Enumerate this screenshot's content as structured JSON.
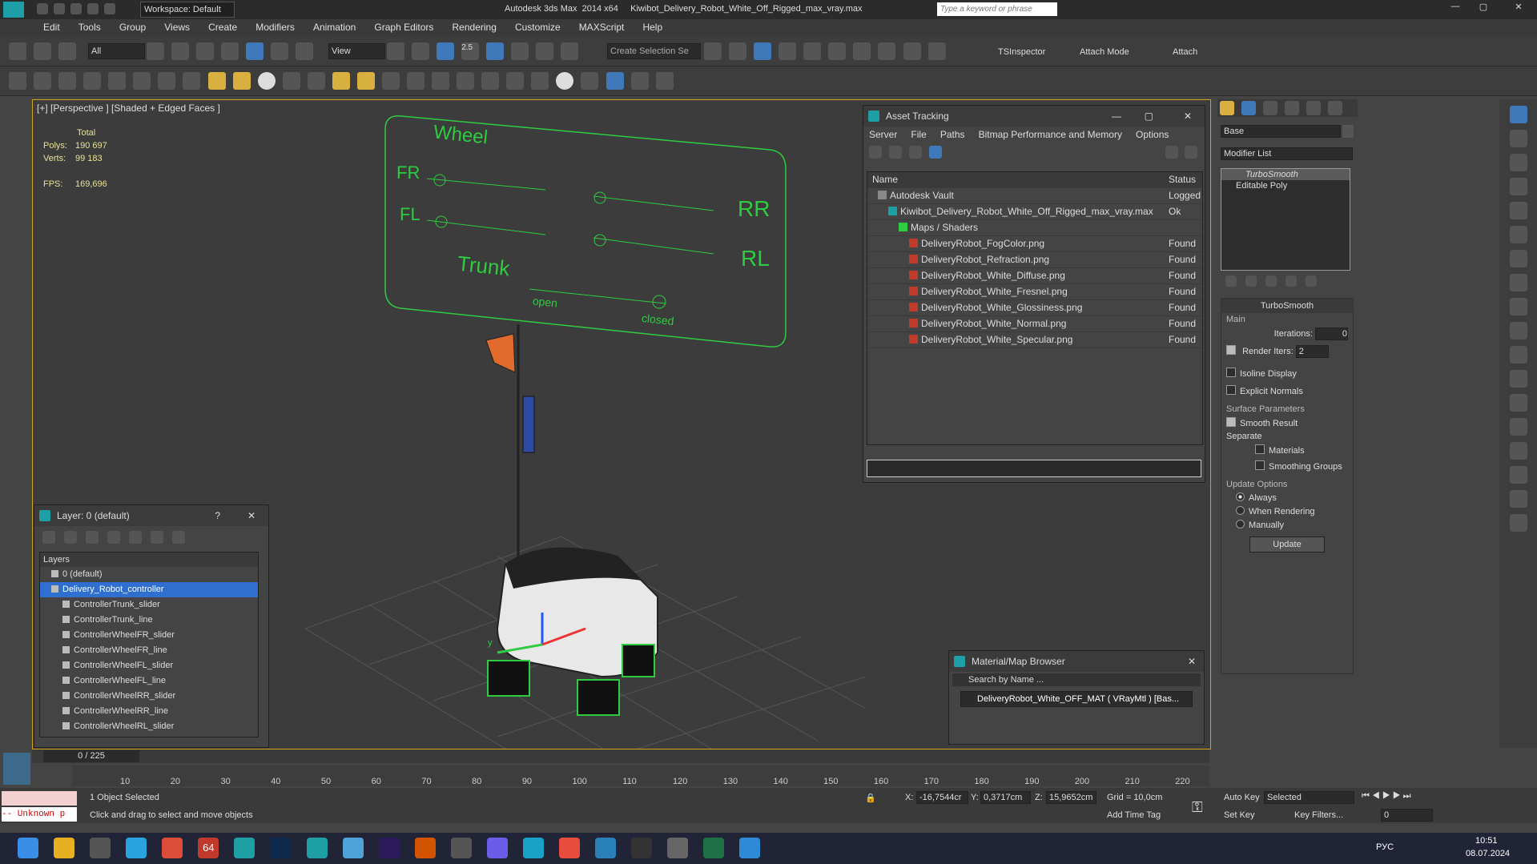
{
  "titlebar": {
    "workspace_label": "Workspace: Default",
    "title": "Autodesk 3ds Max  2014 x64     Kiwibot_Delivery_Robot_White_Off_Rigged_max_vray.max",
    "search_placeholder": "Type a keyword or phrase"
  },
  "menu": [
    "Edit",
    "Tools",
    "Group",
    "Views",
    "Create",
    "Modifiers",
    "Animation",
    "Graph Editors",
    "Rendering",
    "Customize",
    "MAXScript",
    "Help"
  ],
  "toolbar": {
    "filter_value": "All",
    "view_value": "View",
    "snap_value": "2.5",
    "selection_set_placeholder": "Create Selection Se",
    "tsinspector_label": "TSInspector",
    "attach_mode_label": "Attach Mode",
    "attach_label": "Attach"
  },
  "viewport": {
    "label": "[+] [Perspective ] [Shaded + Edged Faces ]",
    "stats_header": "Total",
    "polys_label": "Polys:",
    "polys_value": "190 697",
    "verts_label": "Verts:",
    "verts_value": "99 183",
    "fps_label": "FPS:",
    "fps_value": "169,696",
    "controller": {
      "wheel": "Wheel",
      "fr": "FR",
      "fl": "FL",
      "rr": "RR",
      "rl": "RL",
      "trunk": "Trunk",
      "open": "open",
      "closed": "closed"
    },
    "axis_y": "y"
  },
  "asset_tracking": {
    "title": "Asset Tracking",
    "menu": [
      "Server",
      "File",
      "Paths",
      "Bitmap Performance and Memory",
      "Options"
    ],
    "col_name": "Name",
    "col_status": "Status",
    "rows": [
      {
        "name": "Autodesk Vault",
        "status": "Logged",
        "indent": 1,
        "type": "vault"
      },
      {
        "name": "Kiwibot_Delivery_Robot_White_Off_Rigged_max_vray.max",
        "status": "Ok",
        "indent": 2,
        "type": "max"
      },
      {
        "name": "Maps / Shaders",
        "status": "",
        "indent": 3,
        "type": "folder"
      },
      {
        "name": "DeliveryRobot_FogColor.png",
        "status": "Found",
        "indent": 4,
        "type": "png"
      },
      {
        "name": "DeliveryRobot_Refraction.png",
        "status": "Found",
        "indent": 4,
        "type": "png"
      },
      {
        "name": "DeliveryRobot_White_Diffuse.png",
        "status": "Found",
        "indent": 4,
        "type": "png"
      },
      {
        "name": "DeliveryRobot_White_Fresnel.png",
        "status": "Found",
        "indent": 4,
        "type": "png"
      },
      {
        "name": "DeliveryRobot_White_Glossiness.png",
        "status": "Found",
        "indent": 4,
        "type": "png"
      },
      {
        "name": "DeliveryRobot_White_Normal.png",
        "status": "Found",
        "indent": 4,
        "type": "png"
      },
      {
        "name": "DeliveryRobot_White_Specular.png",
        "status": "Found",
        "indent": 4,
        "type": "png"
      }
    ]
  },
  "layer_window": {
    "title": "Layer: 0 (default)",
    "help": "?",
    "header": "Layers",
    "rows": [
      {
        "name": "0 (default)",
        "level": 0,
        "selected": false
      },
      {
        "name": "Delivery_Robot_controller",
        "level": 0,
        "selected": true
      },
      {
        "name": "ControllerTrunk_slider",
        "level": 1,
        "selected": false
      },
      {
        "name": "ControllerTrunk_line",
        "level": 1,
        "selected": false
      },
      {
        "name": "ControllerWheelFR_slider",
        "level": 1,
        "selected": false
      },
      {
        "name": "ControllerWheelFR_line",
        "level": 1,
        "selected": false
      },
      {
        "name": "ControllerWheelFL_slider",
        "level": 1,
        "selected": false
      },
      {
        "name": "ControllerWheelFL_line",
        "level": 1,
        "selected": false
      },
      {
        "name": "ControllerWheelRR_slider",
        "level": 1,
        "selected": false
      },
      {
        "name": "ControllerWheelRR_line",
        "level": 1,
        "selected": false
      },
      {
        "name": "ControllerWheelRL_slider",
        "level": 1,
        "selected": false
      }
    ]
  },
  "material_browser": {
    "title": "Material/Map Browser",
    "search_placeholder": "Search by Name ...",
    "item_label": "DeliveryRobot_White_OFF_MAT  ( VRayMtl )  [Bas..."
  },
  "command_panel": {
    "object_name": "Base",
    "modifier_list": "Modifier List",
    "stack": [
      "TurboSmooth",
      "Editable Poly"
    ],
    "turbosmooth_title": "TurboSmooth",
    "main_label": "Main",
    "iterations_label": "Iterations:",
    "iterations_value": "0",
    "render_iters_label": "Render Iters:",
    "render_iters_value": "2",
    "isoline_label": "Isoline Display",
    "explicit_normals_label": "Explicit Normals",
    "surface_params_label": "Surface Parameters",
    "smooth_result_label": "Smooth Result",
    "separate_label": "Separate",
    "materials_label": "Materials",
    "smoothing_groups_label": "Smoothing Groups",
    "update_options_label": "Update Options",
    "always_label": "Always",
    "when_rendering_label": "When Rendering",
    "manually_label": "Manually",
    "update_button": "Update"
  },
  "timeline": {
    "frame_label": "0 / 225",
    "ticks": [
      "10",
      "20",
      "30",
      "40",
      "50",
      "60",
      "70",
      "80",
      "90",
      "100",
      "110",
      "120",
      "130",
      "140",
      "150",
      "160",
      "170",
      "180",
      "190",
      "200",
      "210",
      "220"
    ]
  },
  "status_bar": {
    "script_label": "-- Unknown p",
    "selected_text": "1 Object Selected",
    "hint_text": "Click and drag to select and move objects",
    "x_label": "X:",
    "x_value": "-16,7544cr",
    "y_label": "Y:",
    "y_value": "0,3717cm",
    "z_label": "Z:",
    "z_value": "15,9652cm",
    "grid_text": "Grid = 10,0cm",
    "add_time_tag": "Add Time Tag",
    "auto_key": "Auto Key",
    "set_key": "Set Key",
    "selected_dropdown": "Selected",
    "key_filters": "Key Filters...",
    "frame_value": "0"
  },
  "taskbar": {
    "lang": "РУС",
    "time": "10:51",
    "date": "08.07.2024",
    "badge": "64"
  }
}
